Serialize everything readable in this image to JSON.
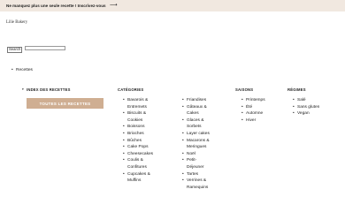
{
  "banner": {
    "text": "Ne manquez plus une seule recette ! Inscrivez-vous",
    "arrow_icon": "arrow-right-icon"
  },
  "site": {
    "logo": "Lilie Bakery"
  },
  "search": {
    "button_label": "Search",
    "value": ""
  },
  "breadcrumb": {
    "items": [
      "Recettes"
    ]
  },
  "index": {
    "title": "INDEX DES RECETTES",
    "all_button": "TOUTES LES RECETTES"
  },
  "categories": {
    "title": "CATÉGORIES",
    "col1": [
      "Bavarois & Entremets",
      "Biscuits & Cookies",
      "Boissons",
      "Brioches",
      "Bûches",
      "Cake Pops",
      "Cheesecakes",
      "Coulis & Confitures",
      "Cupcakes & Muffins"
    ],
    "col2": [
      "Friandises",
      "Gâteaux & Cakes",
      "Glaces & Sorbets",
      "Layer cakes",
      "Macarons & Meringues",
      "Noël",
      "Petit-Déjeuner",
      "Tartes",
      "Verrines & Ramequins"
    ]
  },
  "seasons": {
    "title": "SAISONS",
    "items": [
      "Printemps",
      "Été",
      "Automne",
      "Hiver"
    ]
  },
  "diets": {
    "title": "RÉGIMES",
    "items": [
      "Salé",
      "Sans gluten",
      "Vegan"
    ]
  }
}
